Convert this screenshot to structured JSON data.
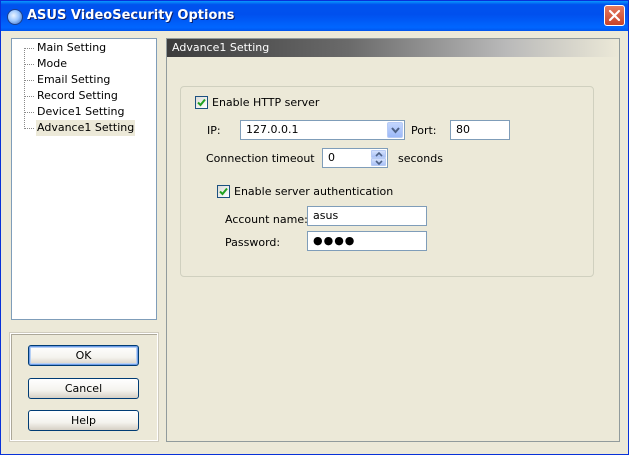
{
  "window": {
    "title": "ASUS VideoSecurity Options",
    "titlebar_color": "#0054E3"
  },
  "sidebar": {
    "items": [
      {
        "label": "Main Setting"
      },
      {
        "label": "Mode"
      },
      {
        "label": "Email Setting"
      },
      {
        "label": "Record Setting"
      },
      {
        "label": "Device1 Setting"
      },
      {
        "label": "Advance1 Setting"
      }
    ],
    "selected": "Advance1 Setting"
  },
  "buttons": {
    "ok_label": "OK",
    "cancel_label": "Cancel",
    "help_label": "Help"
  },
  "panel": {
    "header": "Advance1 Setting"
  },
  "http": {
    "enable_label": "Enable HTTP server",
    "enable_checked": true,
    "ip_label": "IP:",
    "ip_value": "127.0.0.1",
    "port_label": "Port:",
    "port_value": "80",
    "timeout_label": "Connection timeout",
    "timeout_value": "0",
    "timeout_unit": "seconds"
  },
  "auth": {
    "enable_label": "Enable server authentication",
    "enable_checked": true,
    "account_label": "Account name:",
    "account_value": "asus",
    "password_label": "Password:",
    "password_value": "●●●●"
  }
}
